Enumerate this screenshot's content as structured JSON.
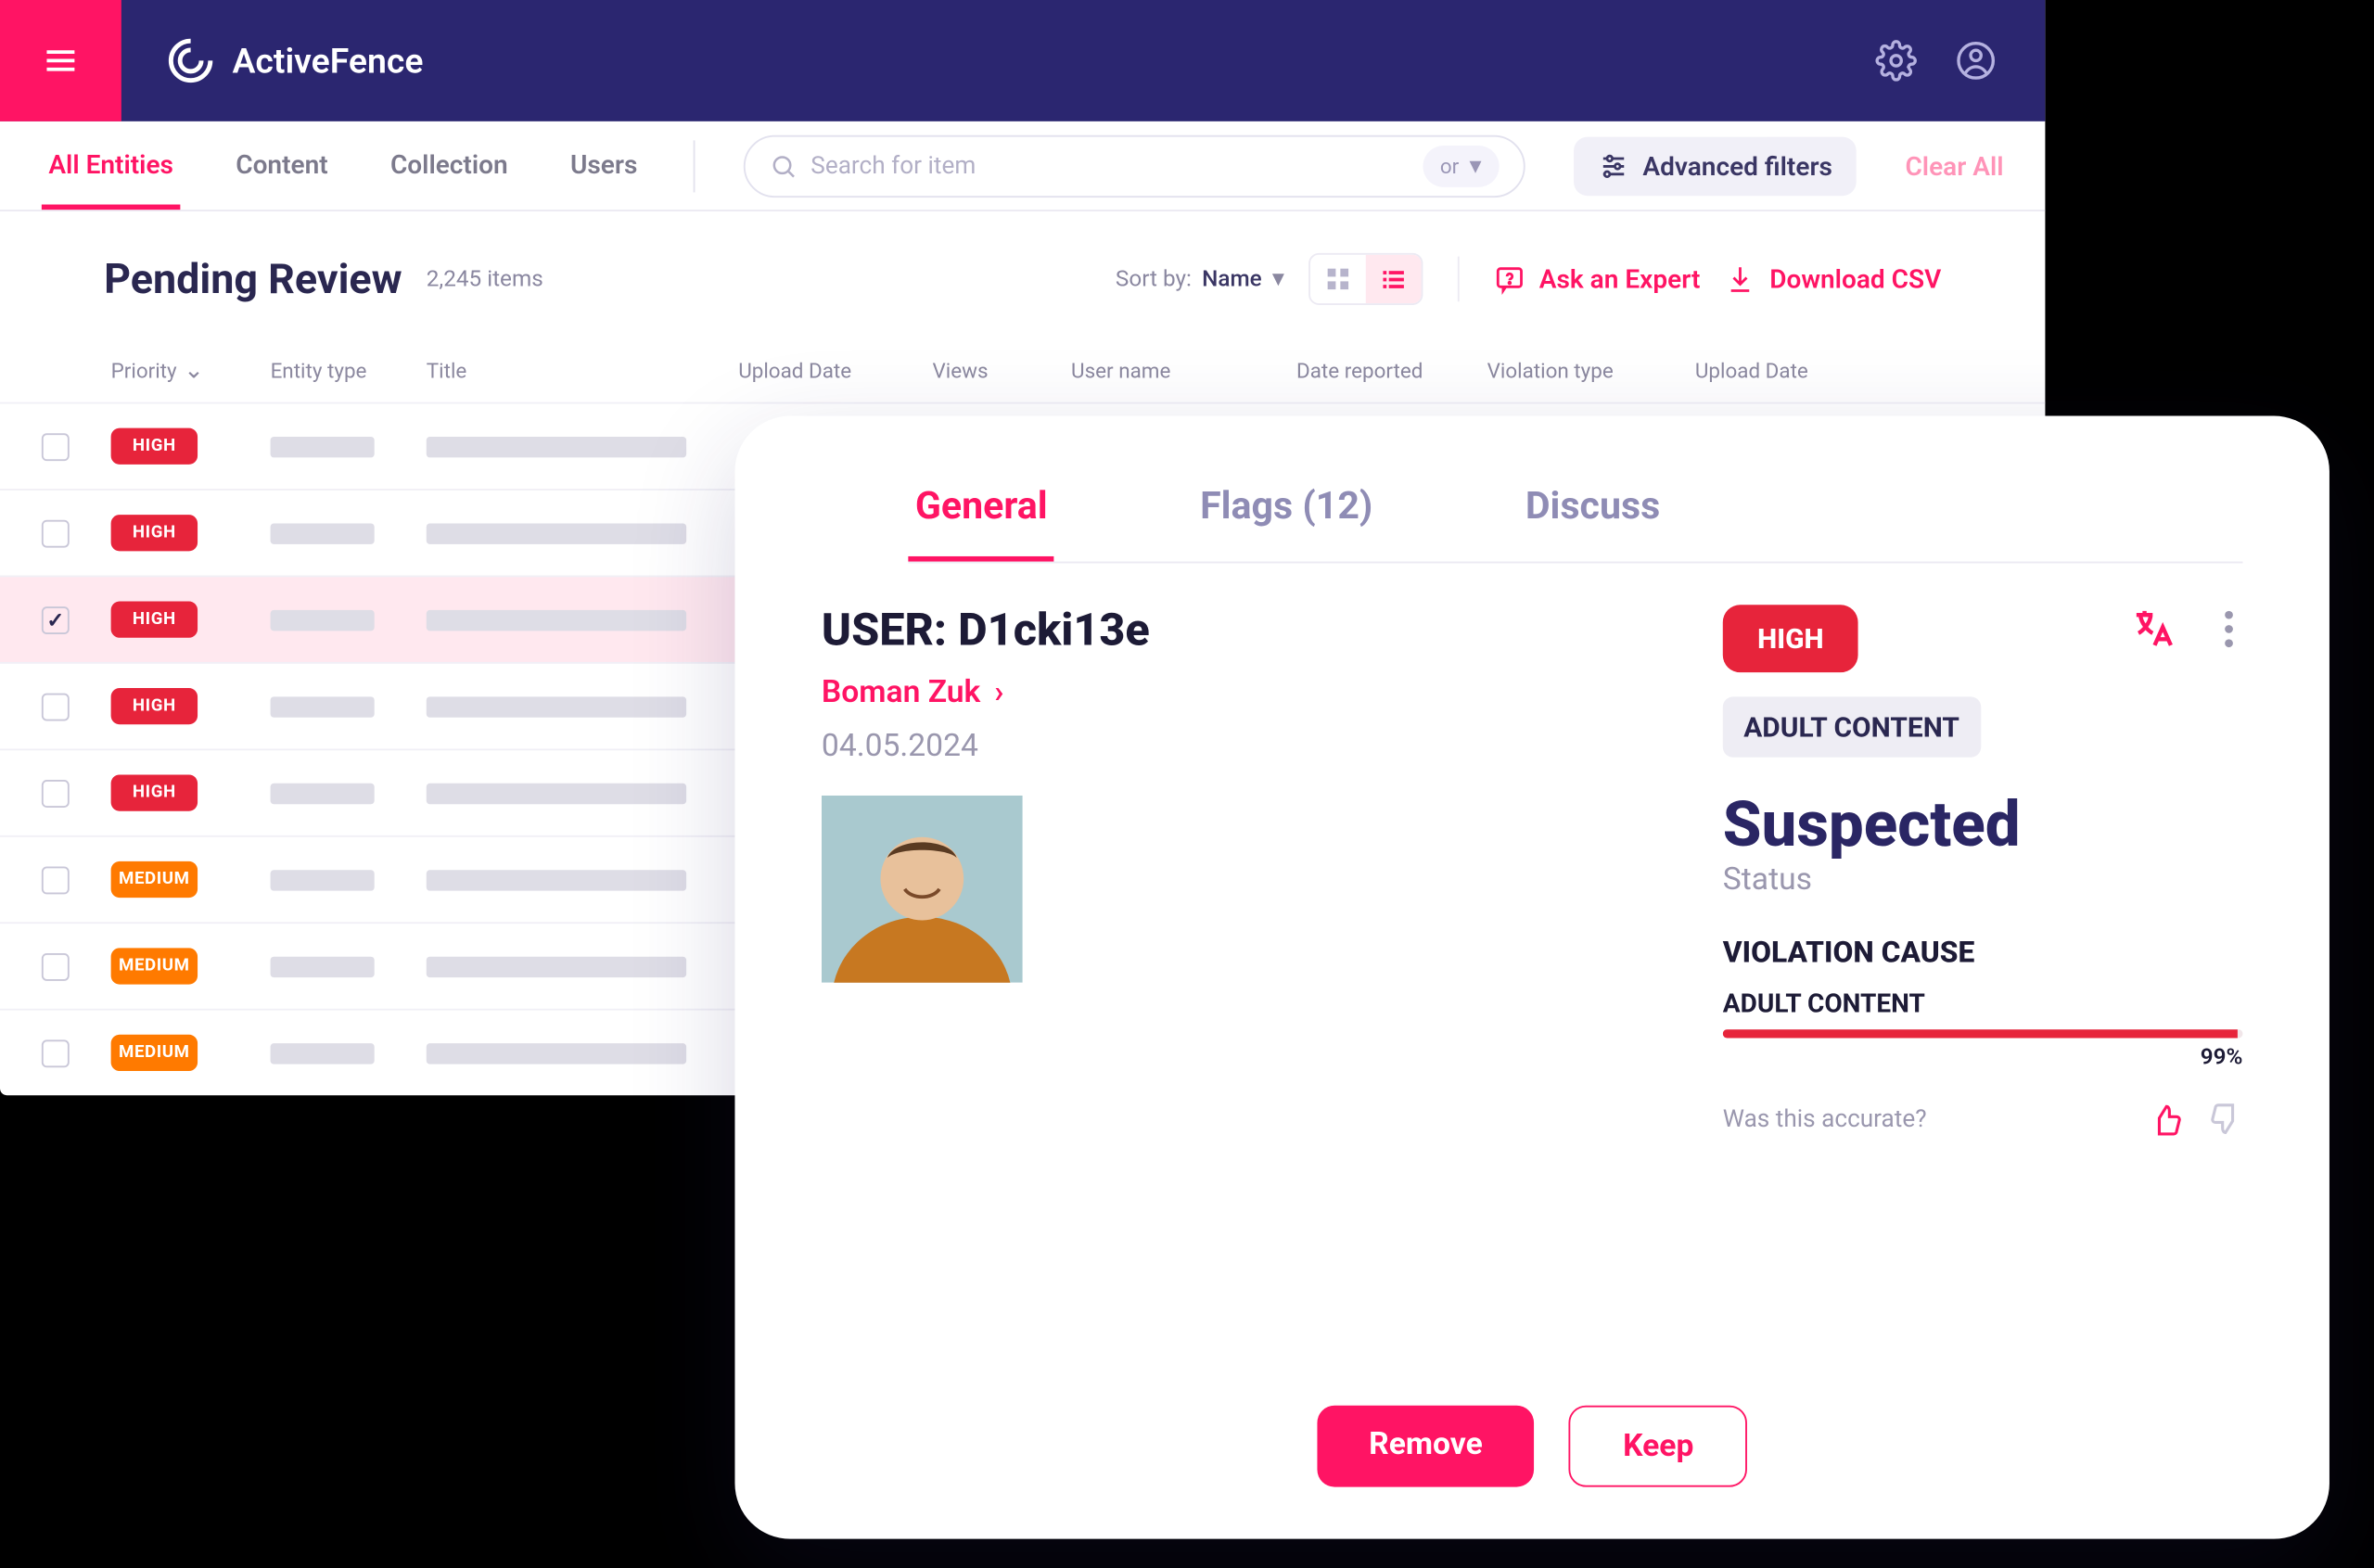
{
  "brand": "ActiveFence",
  "nav": {
    "tabs": [
      "All Entities",
      "Content",
      "Collection",
      "Users"
    ],
    "active": 0,
    "search_placeholder": "Search for item",
    "or_label": "or",
    "advanced_filters": "Advanced filters",
    "clear_all": "Clear All"
  },
  "header": {
    "title": "Pending Review",
    "count": "2,245 items",
    "sort_label": "Sort by:",
    "sort_value": "Name",
    "ask_expert": "Ask an Expert",
    "download_csv": "Download CSV"
  },
  "columns": {
    "priority": "Priority",
    "entity_type": "Entity type",
    "title": "Title",
    "upload_date": "Upload Date",
    "views": "Views",
    "user_name": "User name",
    "date_reported": "Date reported",
    "violation_type": "Violation type",
    "upload_date2": "Upload Date"
  },
  "rows": [
    {
      "priority": "HIGH",
      "level": "high",
      "selected": false
    },
    {
      "priority": "HIGH",
      "level": "high",
      "selected": false
    },
    {
      "priority": "HIGH",
      "level": "high",
      "selected": true
    },
    {
      "priority": "HIGH",
      "level": "high",
      "selected": false
    },
    {
      "priority": "HIGH",
      "level": "high",
      "selected": false
    },
    {
      "priority": "MEDIUM",
      "level": "medium",
      "selected": false
    },
    {
      "priority": "MEDIUM",
      "level": "medium",
      "selected": false
    },
    {
      "priority": "MEDIUM",
      "level": "medium",
      "selected": false
    }
  ],
  "detail": {
    "tabs": {
      "general": "General",
      "flags": "Flags (12)",
      "discuss": "Discuss",
      "active": "general"
    },
    "user_label": "USER: D1cki13e",
    "user_name": "Boman Zuk",
    "date": "04.05.2024",
    "priority": "HIGH",
    "violation_chip": "ADULT CONTENT",
    "status": "Suspected",
    "status_label": "Status",
    "cause_heading": "VIOLATION CAUSE",
    "cause_label": "ADULT CONTENT",
    "cause_percent": "99%",
    "accurate_prompt": "Was this accurate?",
    "remove": "Remove",
    "keep": "Keep"
  },
  "colors": {
    "accent": "#ff1464",
    "navy": "#2b2670",
    "danger": "#e7243b",
    "warn": "#ff7a00"
  }
}
